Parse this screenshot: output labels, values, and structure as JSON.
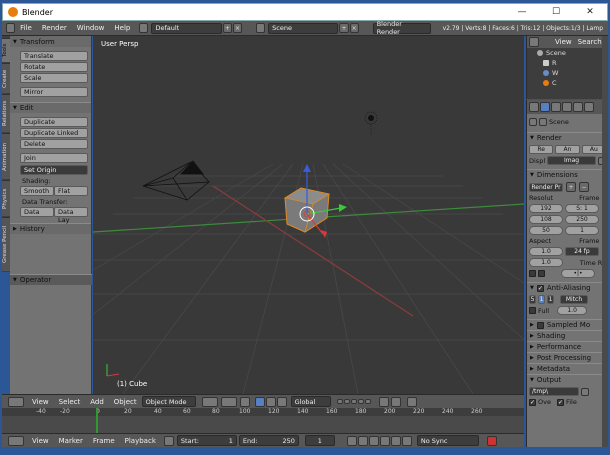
{
  "window": {
    "title": "Blender",
    "minimize": "—",
    "maximize": "☐",
    "close": "✕"
  },
  "info_header": {
    "menus": [
      "File",
      "Render",
      "Window",
      "Help"
    ],
    "layout": "Default",
    "scene": "Scene",
    "engine": "Blender Render",
    "stats": "v2.79 | Verts:8 | Faces:6 | Tris:12 | Objects:1/3 | Lamp"
  },
  "tabs": [
    "Tools",
    "Create",
    "Relations",
    "Animation",
    "Physics",
    "Grease Pencil"
  ],
  "tool_shelf": {
    "transform_title": "Transform",
    "transform_buttons": [
      "Translate",
      "Rotate",
      "Scale"
    ],
    "mirror": "Mirror",
    "edit_title": "Edit",
    "edit_buttons": [
      "Duplicate",
      "Duplicate Linked",
      "Delete"
    ],
    "join": "Join",
    "set_origin": "Set Origin",
    "shading_label": "Shading:",
    "smooth": "Smooth",
    "flat": "Flat",
    "data_transfer_label": "Data Transfer:",
    "data": "Data",
    "data_lay": "Data Lay",
    "history_title": "History",
    "operator_title": "Operator"
  },
  "viewport": {
    "view_label": "User Persp",
    "object_label": "(1) Cube"
  },
  "viewport_header": {
    "menus": [
      "View",
      "Select",
      "Add",
      "Object"
    ],
    "mode": "Object Mode",
    "orientation": "Global"
  },
  "timeline": {
    "ticks": [
      "-40",
      "-20",
      "0",
      "20",
      "40",
      "60",
      "80",
      "100",
      "120",
      "140",
      "160",
      "180",
      "200",
      "220",
      "240",
      "260"
    ],
    "menus": [
      "View",
      "Marker",
      "Frame",
      "Playback"
    ],
    "start_label": "Start:",
    "start_value": "1",
    "end_label": "End:",
    "end_value": "250",
    "current_frame": "1",
    "sync": "No Sync"
  },
  "outliner": {
    "view": "View",
    "search": "Search",
    "items": [
      "Scene",
      "R",
      "W",
      "C"
    ]
  },
  "properties": {
    "scene_label": "Scene",
    "render_title": "Render",
    "render_buttons": [
      "Re",
      "An",
      "Au"
    ],
    "display_label": "Displ",
    "display_value": "Imag",
    "dimensions_title": "Dimensions",
    "preset": "Render Pr",
    "resolution_label": "Resolut",
    "frame_range_label": "Frame R",
    "res_x": "192",
    "res_y": "108",
    "res_pct": "50",
    "frame_start": "S: 1",
    "frame_end": "250",
    "frame_step": "1",
    "aspect_label": "Aspect",
    "frame_rate_label": "Frame R",
    "aspect_x": "1.0",
    "aspect_y": "1.0",
    "fps": "24 fp",
    "time_remap_label": "Time Re",
    "aa_title": "Anti-Aliasing",
    "aa_samples": [
      "5",
      "1",
      "1"
    ],
    "aa_filter": "Mitch",
    "full_label": "Full",
    "full_value": "1.0",
    "sampled_mb": "Sampled Mo",
    "shading": "Shading",
    "performance": "Performance",
    "post_processing": "Post Processing",
    "metadata": "Metadata",
    "output_title": "Output",
    "output_path": "/tmp\\",
    "overwrite": "Ove",
    "file_ext": "File"
  }
}
